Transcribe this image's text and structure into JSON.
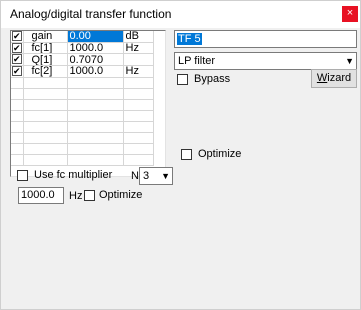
{
  "window": {
    "title": "Analog/digital transfer function",
    "close_glyph": "×"
  },
  "params": [
    {
      "checked": true,
      "name": "gain",
      "value": "0.00",
      "unit": "dB",
      "selected": true
    },
    {
      "checked": true,
      "name": "fc[1]",
      "value": "1000.0",
      "unit": "Hz",
      "selected": false
    },
    {
      "checked": true,
      "name": "Q[1]",
      "value": "0.7070",
      "unit": "",
      "selected": false
    },
    {
      "checked": true,
      "name": "fc[2]",
      "value": "1000.0",
      "unit": "Hz",
      "selected": false
    },
    {
      "checked": false,
      "name": "",
      "value": "",
      "unit": "",
      "selected": false
    },
    {
      "checked": false,
      "name": "",
      "value": "",
      "unit": "",
      "selected": false
    },
    {
      "checked": false,
      "name": "",
      "value": "",
      "unit": "",
      "selected": false
    },
    {
      "checked": false,
      "name": "",
      "value": "",
      "unit": "",
      "selected": false
    },
    {
      "checked": false,
      "name": "",
      "value": "",
      "unit": "",
      "selected": false
    },
    {
      "checked": false,
      "name": "",
      "value": "",
      "unit": "",
      "selected": false
    },
    {
      "checked": false,
      "name": "",
      "value": "",
      "unit": "",
      "selected": false
    },
    {
      "checked": false,
      "name": "",
      "value": "",
      "unit": "",
      "selected": false
    }
  ],
  "name_field": {
    "value": "TF 5"
  },
  "filter_combo": {
    "value": "LP filter"
  },
  "bypass": {
    "label": "Bypass",
    "checked": false
  },
  "wizard_button": {
    "label": "Wizard"
  },
  "optimize_top": {
    "label": "Optimize",
    "checked": false
  },
  "fc_multiplier": {
    "label": "Use fc multiplier",
    "checked": false
  },
  "n_label": "N",
  "n_combo": {
    "value": "3"
  },
  "freq_input": {
    "value": "1000.0"
  },
  "hz_label": "Hz",
  "optimize_bottom": {
    "label": "Optimize",
    "checked": false
  },
  "colors": {
    "selection": "#0078d7",
    "close": "#e81123"
  }
}
